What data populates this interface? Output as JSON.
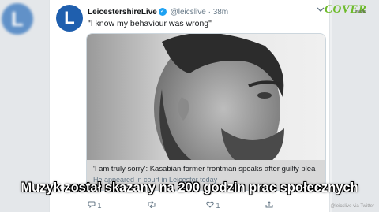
{
  "tweet": {
    "avatar_letter": "L",
    "name": "LeicestershireLive",
    "verified": "✓",
    "handle": "@leicslive",
    "separator": "·",
    "time": "38m",
    "text": "\"I know my behaviour was wrong\""
  },
  "preview": {
    "title": "'I am truly sorry': Kasabian former frontman speaks after guilty plea",
    "description": "He appeared in court in Leicester today"
  },
  "actions": {
    "reply_count": "1",
    "retweet_count": "",
    "like_count": "1"
  },
  "overlay": {
    "logo": "COVER",
    "logo_sub": "media",
    "caption": "Muzyk został skazany na 200 godzin prac społecznych",
    "credit": "@leicslive via Twitter"
  },
  "colors": {
    "accent": "#1da1f2",
    "avatar": "#1f5fae",
    "logo": "#6dbb2a"
  }
}
